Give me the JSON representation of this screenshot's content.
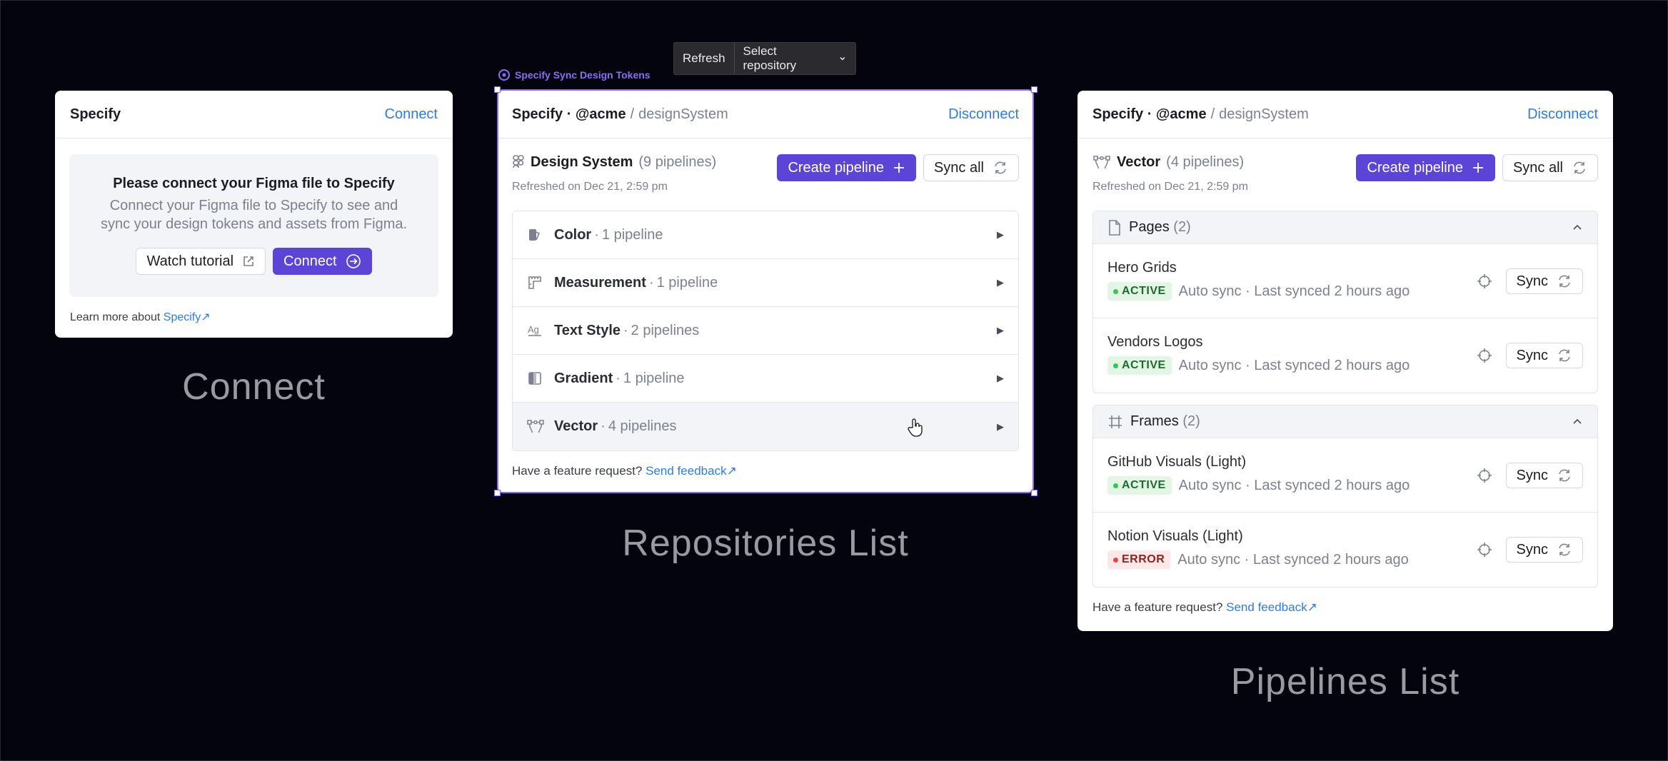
{
  "toolbar": {
    "refresh": "Refresh",
    "select_repo": "Select repository"
  },
  "plugin_label": "Specify Sync Design Tokens",
  "connect_panel": {
    "title": "Specify",
    "connect_link": "Connect",
    "heading": "Please connect your Figma file to Specify",
    "body_line1": "Connect your Figma file to Specify to see and",
    "body_line2": "sync your design tokens and assets from Figma.",
    "watch_tutorial": "Watch tutorial",
    "connect_button": "Connect",
    "learn_prefix": "Learn more about",
    "learn_link": "Specify"
  },
  "repo_panel": {
    "title": "Specify · @acme",
    "separator": "/",
    "repo": "designSystem",
    "disconnect": "Disconnect",
    "section_name": "Design System",
    "section_count": "(9 pipelines)",
    "refreshed": "Refreshed on Dec 21, 2:59 pm",
    "create_pipeline": "Create pipeline",
    "sync_all": "Sync all",
    "rows": [
      {
        "name": "Color",
        "count": "1 pipeline",
        "icon": "color-icon"
      },
      {
        "name": "Measurement",
        "count": "1 pipeline",
        "icon": "measurement-icon"
      },
      {
        "name": "Text Style",
        "count": "2 pipelines",
        "icon": "text-style-icon"
      },
      {
        "name": "Gradient",
        "count": "1 pipeline",
        "icon": "gradient-icon"
      },
      {
        "name": "Vector",
        "count": "4 pipelines",
        "icon": "vector-icon"
      }
    ],
    "feedback_prefix": "Have a feature request?",
    "feedback_link": "Send feedback"
  },
  "pipelines_panel": {
    "title": "Specify · @acme",
    "separator": "/",
    "repo": "designSystem",
    "disconnect": "Disconnect",
    "section_name": "Vector",
    "section_count": "(4 pipelines)",
    "refreshed": "Refreshed on Dec 21, 2:59 pm",
    "create_pipeline": "Create pipeline",
    "sync_all": "Sync all",
    "groups": [
      {
        "name": "Pages",
        "count": "(2)",
        "items": [
          {
            "name": "Hero Grids",
            "status": "ACTIVE",
            "meta": "Auto sync · Last synced 2 hours ago",
            "sync": "Sync"
          },
          {
            "name": "Vendors Logos",
            "status": "ACTIVE",
            "meta": "Auto sync · Last synced 2 hours ago",
            "sync": "Sync"
          }
        ]
      },
      {
        "name": "Frames",
        "count": "(2)",
        "items": [
          {
            "name": "GitHub Visuals (Light)",
            "status": "ACTIVE",
            "meta": "Auto sync · Last synced 2 hours ago",
            "sync": "Sync"
          },
          {
            "name": "Notion Visuals (Light)",
            "status": "ERROR",
            "meta": "Auto sync · Last synced 2 hours ago",
            "sync": "Sync"
          }
        ]
      }
    ],
    "feedback_prefix": "Have a feature request?",
    "feedback_link": "Send feedback"
  },
  "canvas_labels": {
    "connect": "Connect",
    "repositories": "Repositories List",
    "pipelines": "Pipelines List"
  },
  "colors": {
    "accent": "#5c45d6",
    "link": "#2f7be0",
    "background": "#04040f",
    "selection": "#8d6cf5"
  }
}
